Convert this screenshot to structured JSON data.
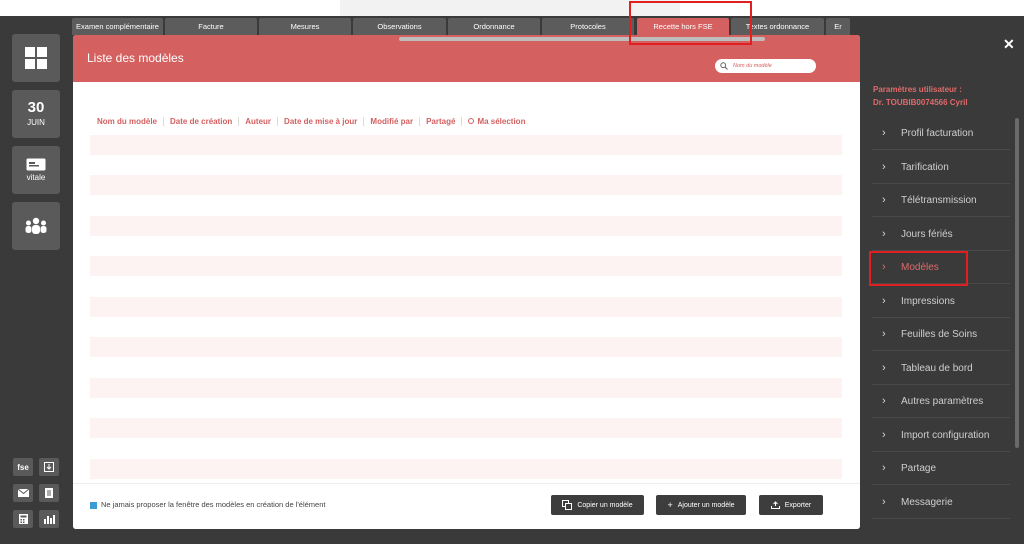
{
  "left_sidebar": {
    "date_day": "30",
    "date_month": "JUIN",
    "vitale_label": "vitale",
    "fse_label": "fse"
  },
  "tabs": [
    {
      "label": "Examen complémentaire"
    },
    {
      "label": "Facture"
    },
    {
      "label": "Mesures"
    },
    {
      "label": "Observations"
    },
    {
      "label": "Ordonnance"
    },
    {
      "label": "Protocoles"
    },
    {
      "label": "Recette hors FSE"
    },
    {
      "label": "Textes ordonnance"
    },
    {
      "label": "Er"
    }
  ],
  "modal": {
    "title": "Liste des modèles",
    "search_placeholder": "Nom du modèle",
    "columns": [
      "Nom du modèle",
      "Date de création",
      "Auteur",
      "Date de mise à jour",
      "Modifié par",
      "Partagé",
      "Ma sélection"
    ],
    "footer_checkbox_label": "Ne jamais proposer la fenêtre des modèles en création de l'élément",
    "copy_button": "Copier un modèle",
    "add_button": "Ajouter un modèle",
    "export_button": "Exporter"
  },
  "right_panel": {
    "title_line1": "Paramètres utilisateur :",
    "title_line2": "Dr. TOUBIB0074566 Cyril",
    "items": [
      {
        "label": "Profil facturation"
      },
      {
        "label": "Tarification"
      },
      {
        "label": "Télétransmission"
      },
      {
        "label": "Jours fériés"
      },
      {
        "label": "Modèles"
      },
      {
        "label": "Impressions"
      },
      {
        "label": "Feuilles de Soins"
      },
      {
        "label": "Tableau de bord"
      },
      {
        "label": "Autres paramètres"
      },
      {
        "label": "Import configuration"
      },
      {
        "label": "Partage"
      },
      {
        "label": "Messagerie"
      }
    ],
    "selected_item": "Modèles"
  },
  "colors": {
    "accent": "#d46060",
    "background": "#3a3a3a",
    "highlight": "#e02020"
  }
}
